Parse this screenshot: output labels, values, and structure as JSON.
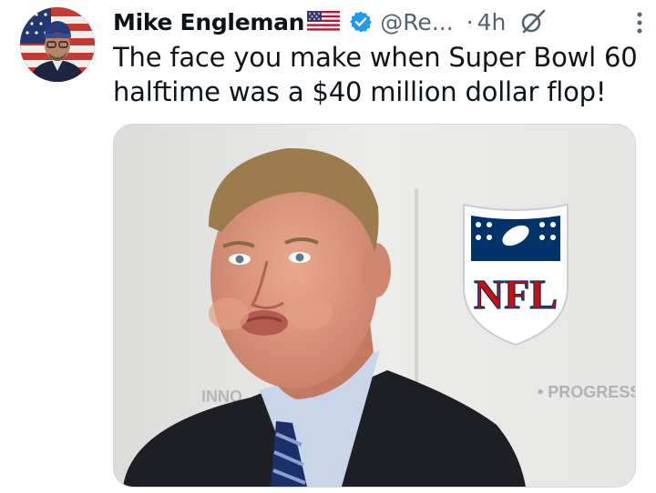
{
  "tweet": {
    "author_name": "Mike Engleman",
    "author_flag": "🇺🇸",
    "handle": "@Re...",
    "separator": "·",
    "time": "4h",
    "text": "The face you make when Super Bowl 60 halftime was a $40 million dollar flop!"
  },
  "media": {
    "logo_text": "NFL",
    "backdrop_text_right": "• PROGRESS",
    "backdrop_text_left": "INNO"
  },
  "colors": {
    "verified_badge": "#1d9bf0",
    "secondary_text": "#536471",
    "nfl_blue": "#013369",
    "nfl_red": "#d50a0a"
  },
  "icons": [
    "verified-icon",
    "grok-icon",
    "more-icon"
  ]
}
